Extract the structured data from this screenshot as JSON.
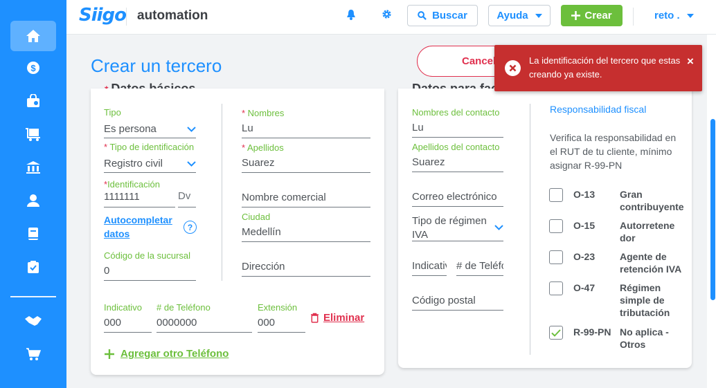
{
  "header": {
    "logo": "Siigo",
    "company": "automation",
    "search_label": "Buscar",
    "help_label": "Ayuda",
    "create_label": "Crear",
    "user_label": "reto ."
  },
  "sidebar": {
    "items": [
      {
        "icon": "home-icon",
        "active": true
      },
      {
        "icon": "dollar-icon"
      },
      {
        "icon": "shopping-bag-icon"
      },
      {
        "icon": "cart-truck-icon"
      },
      {
        "icon": "bank-icon"
      },
      {
        "icon": "user-icon"
      },
      {
        "icon": "book-icon"
      },
      {
        "icon": "clipboard-check-icon"
      },
      {
        "icon": "handshake-icon"
      },
      {
        "icon": "shopping-cart-icon"
      }
    ]
  },
  "page": {
    "title": "Crear un tercero",
    "cancel_label": "Cancelar"
  },
  "basic": {
    "title": "Datos básicos",
    "tipo_label": "Tipo",
    "tipo_value": "Es persona",
    "tipo_id_label": "Tipo de identificación",
    "tipo_id_value": "Registro civil",
    "identificacion_label": "Identificación",
    "identificacion_value": "1111111",
    "dv_placeholder": "Dv",
    "autocomplete_line1": "Autocompletar",
    "autocomplete_line2": "datos",
    "help_symbol": "?",
    "sucursal_label": "Código de la sucursal",
    "sucursal_value": "0",
    "nombres_label": "Nombres",
    "nombres_value": "Lu",
    "apellidos_label": "Apellidos",
    "apellidos_value": "Suarez",
    "nombre_comercial_placeholder": "Nombre comercial",
    "ciudad_label": "Ciudad",
    "ciudad_value": "Medellín",
    "direccion_placeholder": "Dirección",
    "indicativo_label": "Indicativo",
    "indicativo_value": "000",
    "telefono_label": "# de Teléfono",
    "telefono_value": "0000000",
    "extension_label": "Extensión",
    "extension_value": "000",
    "delete_label": "Eliminar",
    "add_phone_label": "Agregar otro Teléfono"
  },
  "billing": {
    "title": "Datos para facturación y envío",
    "contact_name_label": "Nombres del contacto",
    "contact_name_value": "Lu",
    "contact_last_label": "Apellidos del contacto",
    "contact_last_value": "Suarez",
    "email_placeholder": "Correo electrónico",
    "regimen_line1": "Tipo de régimen",
    "regimen_line2": "IVA",
    "indicativo_placeholder": "Indicativo",
    "telefono_placeholder": "# de Teléfono",
    "postal_placeholder": "Código postal"
  },
  "fiscal": {
    "title": "Responsabilidad fiscal",
    "description": "Verifica la responsabilidad en el RUT de tu cliente, mínimo asignar R-99-PN",
    "options": [
      {
        "code": "O-13",
        "label": "Gran contribuyente",
        "checked": false
      },
      {
        "code": "O-15",
        "label": "Autorretenedor",
        "checked": false
      },
      {
        "code": "O-23",
        "label": "Agente de retención IVA",
        "checked": false
      },
      {
        "code": "O-47",
        "label": "Régimen simple de tributación",
        "checked": false
      },
      {
        "code": "R-99-PN",
        "label": "No aplica - Otros",
        "checked": true
      }
    ]
  },
  "toast": {
    "message": "La identificación del tercero que estas creando ya existe.",
    "close_symbol": "×"
  },
  "colors": {
    "primary": "#1e90ff",
    "success": "#6cbf3c",
    "danger": "#e0304e",
    "toast": "#c62f2f"
  }
}
